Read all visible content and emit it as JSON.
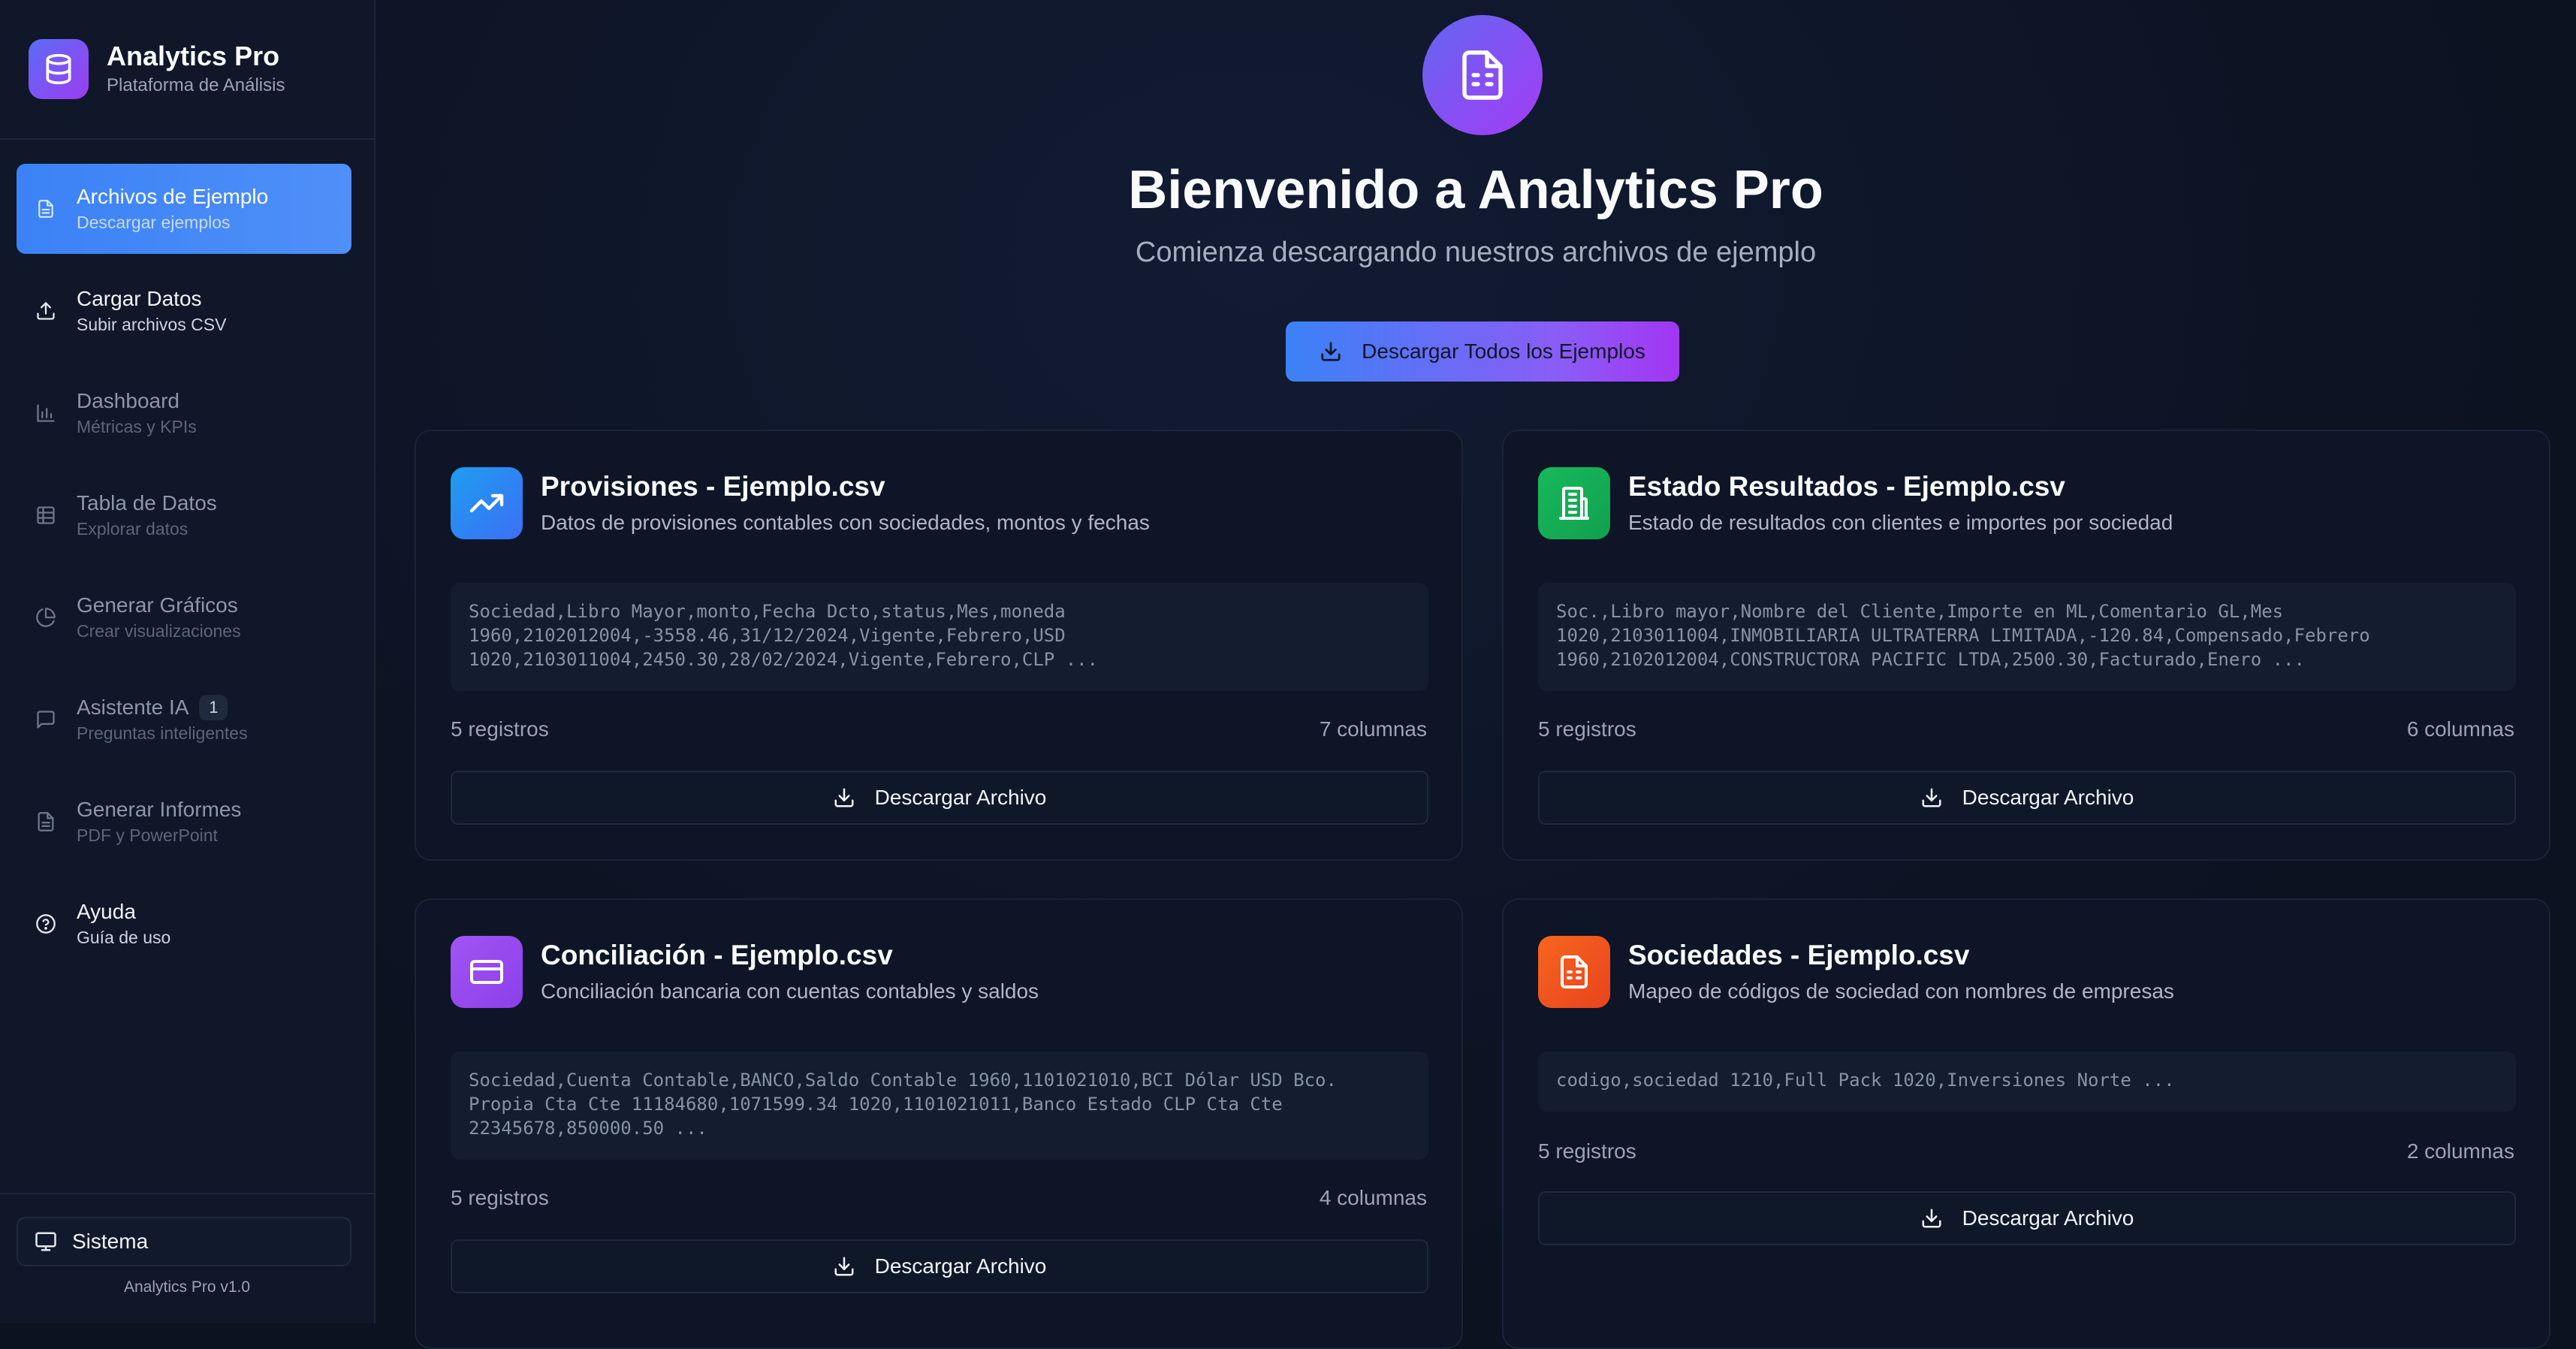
{
  "app": {
    "title": "Analytics Pro",
    "subtitle": "Plataforma de Análisis",
    "version": "Analytics Pro v1.0"
  },
  "sidebar": {
    "items": [
      {
        "label": "Archivos de Ejemplo",
        "sub": "Descargar ejemplos",
        "icon": "file-icon",
        "active": true
      },
      {
        "label": "Cargar Datos",
        "sub": "Subir archivos CSV",
        "icon": "upload-icon"
      },
      {
        "label": "Dashboard",
        "sub": "Métricas y KPIs",
        "icon": "bar-chart-icon"
      },
      {
        "label": "Tabla de Datos",
        "sub": "Explorar datos",
        "icon": "table-icon"
      },
      {
        "label": "Generar Gráficos",
        "sub": "Crear visualizaciones",
        "icon": "pie-chart-icon"
      },
      {
        "label": "Asistente IA",
        "sub": "Preguntas inteligentes",
        "icon": "chat-icon",
        "badge": "1"
      },
      {
        "label": "Generar Informes",
        "sub": "PDF y PowerPoint",
        "icon": "document-icon"
      },
      {
        "label": "Ayuda",
        "sub": "Guía de uso",
        "icon": "help-icon"
      }
    ],
    "system_label": "Sistema"
  },
  "hero": {
    "title": "Bienvenido a Analytics Pro",
    "subtitle": "Comienza descargando nuestros archivos de ejemplo",
    "download_all_label": "Descargar Todos los Ejemplos"
  },
  "cards": [
    {
      "title": "Provisiones - Ejemplo.csv",
      "description": "Datos de provisiones contables con sociedades, montos y fechas",
      "preview": "Sociedad,Libro Mayor,monto,Fecha Dcto,status,Mes,moneda\n1960,2102012004,-3558.46,31/12/2024,Vigente,Febrero,USD\n1020,2103011004,2450.30,28/02/2024,Vigente,Febrero,CLP ...",
      "records": "5 registros",
      "columns": "7 columnas",
      "button_label": "Descargar Archivo",
      "icon": "trending-up-icon",
      "color": "#2f8ff6"
    },
    {
      "title": "Estado Resultados - Ejemplo.csv",
      "description": "Estado de resultados con clientes e importes por sociedad",
      "preview": "Soc.,Libro mayor,Nombre del Cliente,Importe en ML,Comentario GL,Mes\n1020,2103011004,INMOBILIARIA ULTRATERRA LIMITADA,-120.84,Compensado,Febrero\n1960,2102012004,CONSTRUCTORA PACIFIC LTDA,2500.30,Facturado,Enero ...",
      "records": "5 registros",
      "columns": "6 columnas",
      "button_label": "Descargar Archivo",
      "icon": "building-icon",
      "color": "#16b95c"
    },
    {
      "title": "Conciliación - Ejemplo.csv",
      "description": "Conciliación bancaria con cuentas contables y saldos",
      "preview": "Sociedad,Cuenta Contable,BANCO,Saldo Contable 1960,1101021010,BCI Dólar USD Bco. Propia Cta Cte 11184680,1071599.34 1020,1101021011,Banco Estado CLP Cta Cte 22345678,850000.50 ...",
      "records": "5 registros",
      "columns": "4 columnas",
      "button_label": "Descargar Archivo",
      "icon": "credit-card-icon",
      "color": "#9a4cf2"
    },
    {
      "title": "Sociedades - Ejemplo.csv",
      "description": "Mapeo de códigos de sociedad con nombres de empresas",
      "preview": "codigo,sociedad 1210,Full Pack 1020,Inversiones Norte ...",
      "records": "5 registros",
      "columns": "2 columnas",
      "button_label": "Descargar Archivo",
      "icon": "spreadsheet-icon",
      "color": "#f5561f"
    }
  ]
}
